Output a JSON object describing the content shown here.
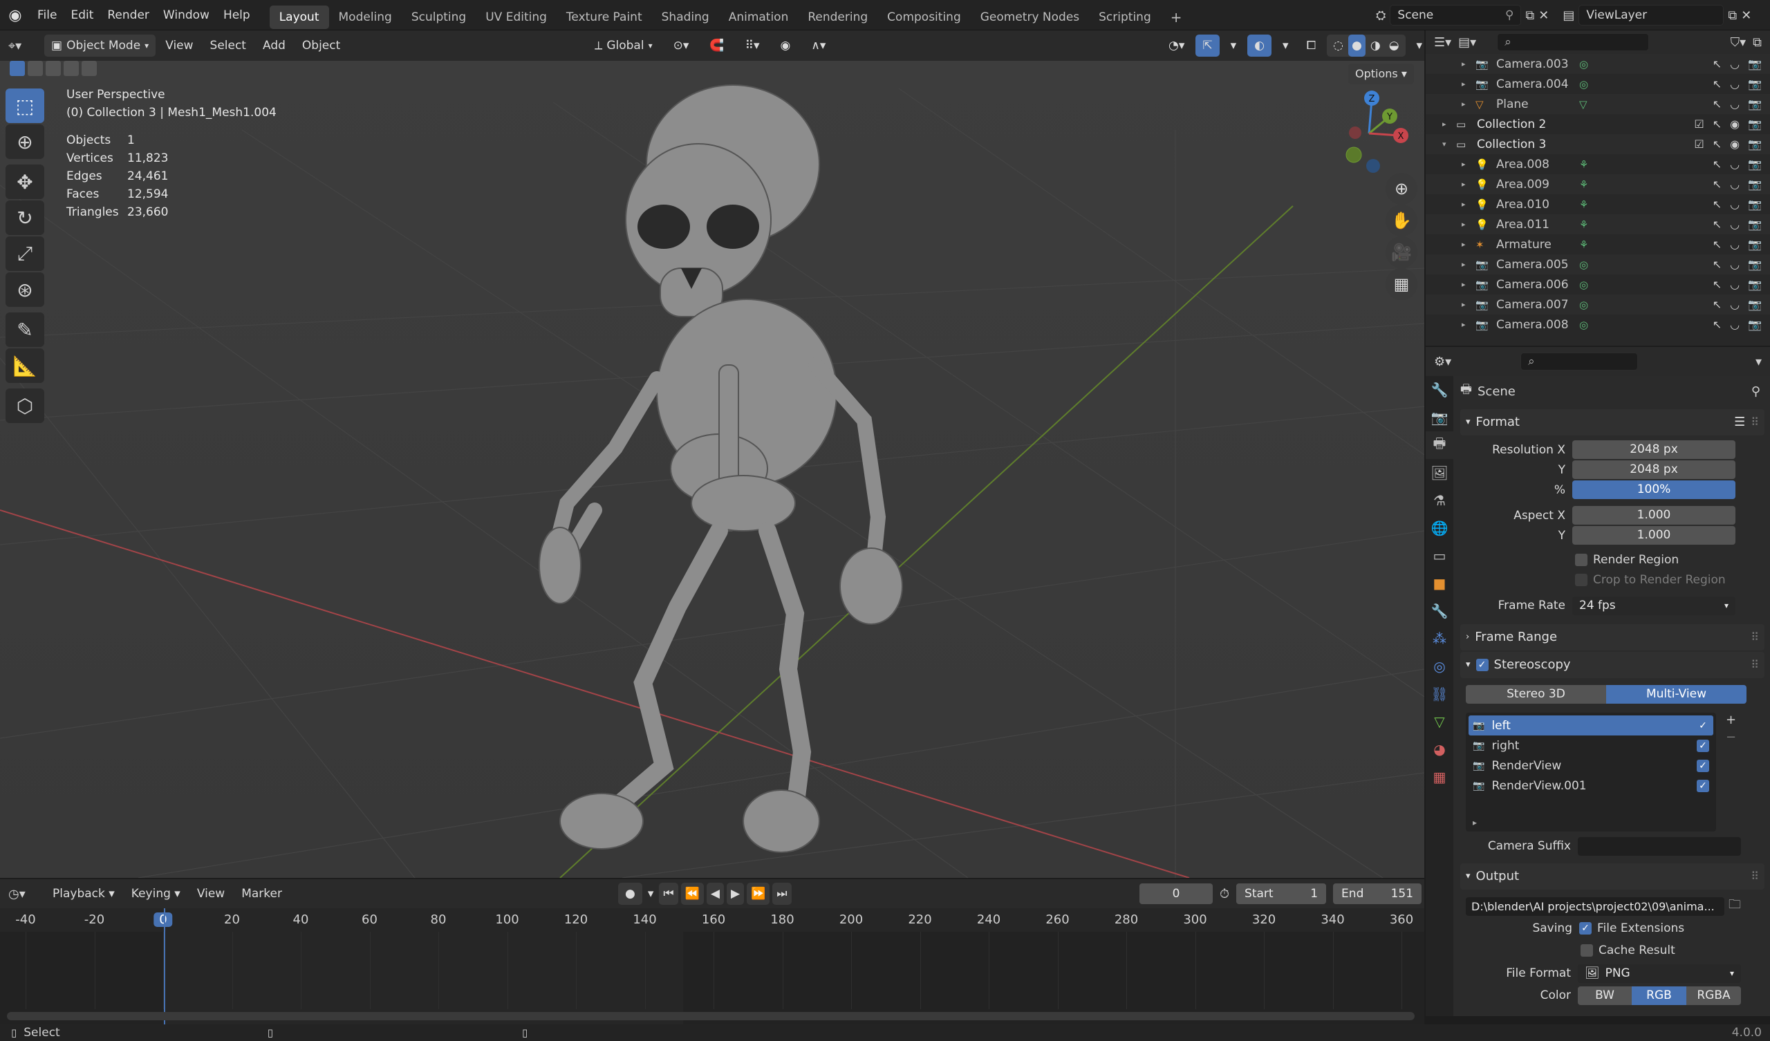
{
  "topbar": {
    "menus": [
      "File",
      "Edit",
      "Render",
      "Window",
      "Help"
    ],
    "workspaces": [
      "Layout",
      "Modeling",
      "Sculpting",
      "UV Editing",
      "Texture Paint",
      "Shading",
      "Animation",
      "Rendering",
      "Compositing",
      "Geometry Nodes",
      "Scripting"
    ],
    "active_workspace": "Layout",
    "add_tab": "+",
    "scene": "Scene",
    "view_layer": "ViewLayer"
  },
  "viewport_header": {
    "mode": "Object Mode",
    "menus": [
      "View",
      "Select",
      "Add",
      "Object"
    ],
    "orientation": "Global",
    "options": "Options"
  },
  "viewport": {
    "view_name": "User Perspective",
    "collection_line": "(0) Collection 3 | Mesh1_Mesh1.004",
    "stats": [
      {
        "label": "Objects",
        "value": "1"
      },
      {
        "label": "Vertices",
        "value": "11,823"
      },
      {
        "label": "Edges",
        "value": "24,461"
      },
      {
        "label": "Faces",
        "value": "12,594"
      },
      {
        "label": "Triangles",
        "value": "23,660"
      }
    ],
    "gizmo": {
      "z": "Z",
      "y": "Y",
      "x": "X"
    }
  },
  "outliner": {
    "rows": [
      {
        "name": "Camera.003",
        "indent": 2,
        "type": "camera"
      },
      {
        "name": "Camera.004",
        "indent": 2,
        "type": "camera"
      },
      {
        "name": "Plane",
        "indent": 2,
        "type": "mesh"
      },
      {
        "name": "Collection 2",
        "indent": 1,
        "type": "collection"
      },
      {
        "name": "Collection 3",
        "indent": 1,
        "type": "collection",
        "expanded": true
      },
      {
        "name": "Area.008",
        "indent": 2,
        "type": "light"
      },
      {
        "name": "Area.009",
        "indent": 2,
        "type": "light"
      },
      {
        "name": "Area.010",
        "indent": 2,
        "type": "light"
      },
      {
        "name": "Area.011",
        "indent": 2,
        "type": "light"
      },
      {
        "name": "Armature",
        "indent": 2,
        "type": "armature"
      },
      {
        "name": "Camera.005",
        "indent": 2,
        "type": "camera"
      },
      {
        "name": "Camera.006",
        "indent": 2,
        "type": "camera"
      },
      {
        "name": "Camera.007",
        "indent": 2,
        "type": "camera"
      },
      {
        "name": "Camera.008",
        "indent": 2,
        "type": "camera"
      }
    ]
  },
  "properties": {
    "context": "Scene",
    "format": {
      "title": "Format",
      "resolution_x_label": "Resolution X",
      "resolution_x": "2048 px",
      "resolution_y_label": "Y",
      "resolution_y": "2048 px",
      "percent_label": "%",
      "percent": "100%",
      "aspect_x_label": "Aspect X",
      "aspect_x": "1.000",
      "aspect_y_label": "Y",
      "aspect_y": "1.000",
      "render_region": "Render Region",
      "crop_region": "Crop to Render Region",
      "frame_rate_label": "Frame Rate",
      "frame_rate": "24 fps"
    },
    "frame_range": "Frame Range",
    "stereoscopy": {
      "title": "Stereoscopy",
      "stereo_3d": "Stereo 3D",
      "multi_view": "Multi-View",
      "views": [
        "left",
        "right",
        "RenderView",
        "RenderView.001"
      ],
      "camera_suffix": "Camera Suffix"
    },
    "output": {
      "title": "Output",
      "path": "D:\\blender\\AI projects\\project02\\09\\anima...",
      "saving_label": "Saving",
      "file_extensions": "File Extensions",
      "cache_result": "Cache Result",
      "file_format_label": "File Format",
      "file_format": "PNG",
      "color_label": "Color",
      "color_options": [
        "BW",
        "RGB",
        "RGBA"
      ],
      "color_selected": "RGB"
    }
  },
  "timeline": {
    "menus": [
      "Playback",
      "Keying",
      "View",
      "Marker"
    ],
    "current_frame": "0",
    "start_label": "Start",
    "start": "1",
    "end_label": "End",
    "end": "151",
    "ticks": [
      "-40",
      "-20",
      "0",
      "20",
      "40",
      "60",
      "80",
      "100",
      "120",
      "140",
      "160",
      "180",
      "200",
      "220",
      "240",
      "260",
      "280",
      "300",
      "320",
      "340",
      "360"
    ]
  },
  "statusbar": {
    "select": "Select",
    "version": "4.0.0"
  },
  "colors": {
    "accent": "#4772b3",
    "x_axis": "#c8454c",
    "y_axis": "#6e9a32",
    "z_axis": "#3e82d6"
  }
}
